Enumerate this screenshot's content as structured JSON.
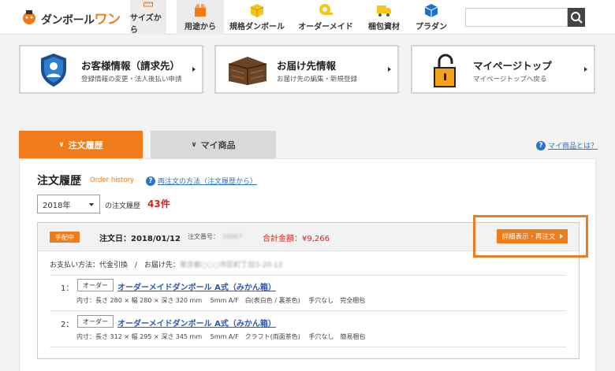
{
  "header": {
    "logo_text": "ダンボール",
    "logo_accent": "ワン",
    "nav": [
      {
        "label": "サイズから",
        "icon": "ruler-icon"
      },
      {
        "label": "用途から",
        "icon": "box-open-icon"
      },
      {
        "label": "規格ダンボール",
        "icon": "cardboard-box-icon"
      },
      {
        "label": "オーダーメイド",
        "icon": "tape-icon"
      },
      {
        "label": "梱包資材",
        "icon": "truck-icon"
      },
      {
        "label": "プラダン",
        "icon": "blue-box-icon"
      }
    ],
    "search_placeholder": ""
  },
  "cards": [
    {
      "title": "お客様情報（請求先）",
      "sub": "登録情報の変更・法人後払い申請",
      "icon": "user-shield-icon"
    },
    {
      "title": "お届け先情報",
      "sub": "お届け先の編集・新規登録",
      "icon": "wooden-crate-icon"
    },
    {
      "title": "マイページトップ",
      "sub": "マイページトップへ戻る",
      "icon": "padlock-icon"
    }
  ],
  "tabs": {
    "active": "注文履歴",
    "inactive": "マイ商品"
  },
  "help_link": "マイ商品とは？",
  "panel": {
    "title": "注文履歴",
    "subtitle": "Order history",
    "reorder_help": "再注文の方法（注文履歴から）",
    "year_selected": "2018年",
    "count_label": "の注文履歴",
    "count": "43件"
  },
  "order": {
    "status": "手配中",
    "date": "注文日：2018/01/12",
    "number_label": "注文番号：",
    "number_value": "26067",
    "total": "合計金額：¥9,266",
    "detail_button": "詳細表示・再注文",
    "payment": "お支払い方法：代金引換",
    "separator": "/",
    "ship_label": "お届け先：",
    "ship_value": "東京都○○○市区町丁目3-20-12",
    "items": [
      {
        "no": "1：",
        "tag": "オーダー",
        "name": "オーダーメイドダンボール A式（みかん箱）",
        "spec": "内寸：長さ 280 × 幅 280 × 深さ 320 mm　 5mm A/F　白(表白色 / 裏茶色)　 手穴なし　完全梱包"
      },
      {
        "no": "2：",
        "tag": "オーダー",
        "name": "オーダーメイドダンボール A式（みかん箱）",
        "spec": "内寸：長さ 312 × 幅 295 × 深さ 345 mm　 5mm A/F　クラフト(両面茶色)　 手穴なし　簡易梱包"
      }
    ]
  },
  "colors": {
    "accent": "#f07b1a",
    "link": "#2a75c9",
    "price": "#d0271b"
  }
}
